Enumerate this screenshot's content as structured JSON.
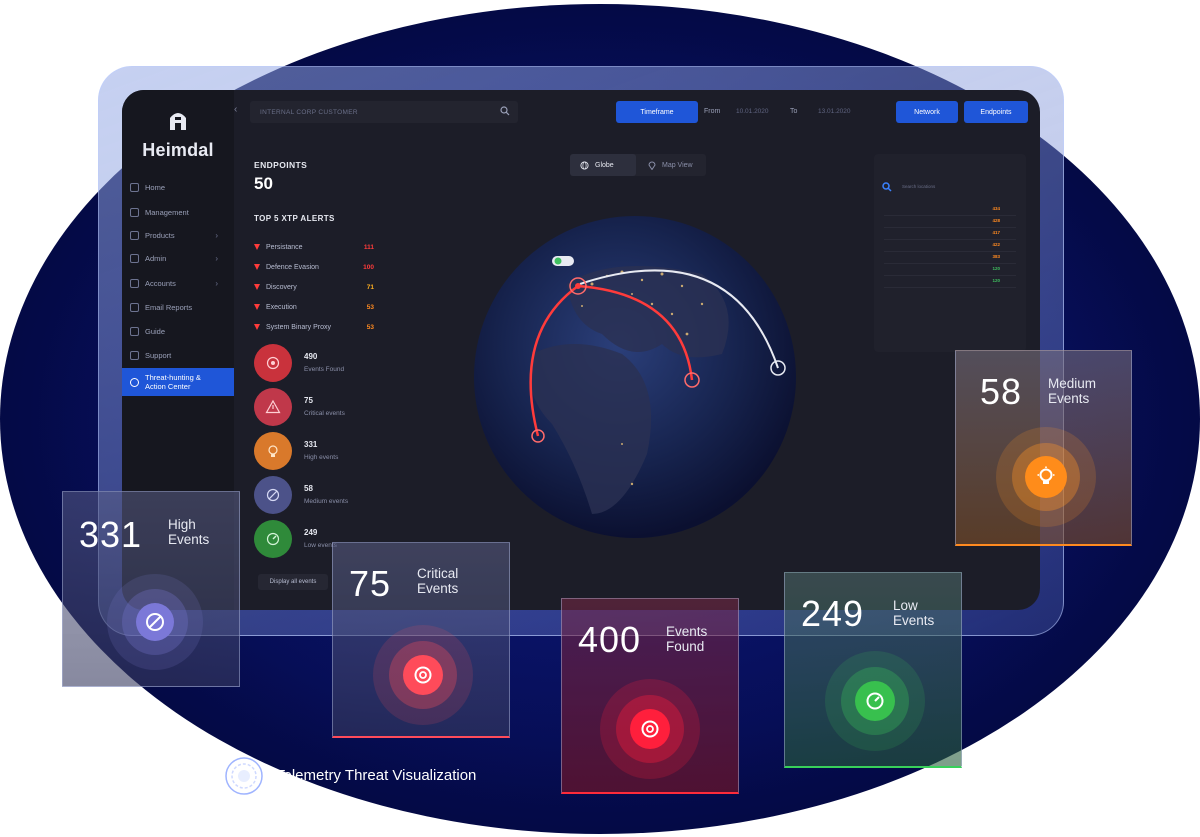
{
  "brand": {
    "name": "Heimdal"
  },
  "sidebar": {
    "items": [
      {
        "label": "Home"
      },
      {
        "label": "Management"
      },
      {
        "label": "Products"
      },
      {
        "label": "Admin"
      },
      {
        "label": "Accounts"
      },
      {
        "label": "Email Reports"
      },
      {
        "label": "Guide"
      },
      {
        "label": "Support"
      },
      {
        "label": "Threat-hunting & Action Center"
      }
    ]
  },
  "topbar": {
    "search_placeholder": "INTERNAL CORP CUSTOMER",
    "timeframe_label": "Timeframe",
    "from_label": "From",
    "from_value": "10.01.2020",
    "to_label": "To",
    "to_value": "13.01.2020",
    "network_label": "Network",
    "endpoints_label": "Endpoints"
  },
  "endpoints": {
    "label": "ENDPOINTS",
    "value": "50"
  },
  "xtp_alerts": {
    "title": "TOP 5 XTP ALERTS",
    "items": [
      {
        "name": "Persistance",
        "count": "111",
        "color": "#ff3b3b"
      },
      {
        "name": "Defence Evasion",
        "count": "100",
        "color": "#ff3b3b"
      },
      {
        "name": "Discovery",
        "count": "71",
        "color": "#ffb020"
      },
      {
        "name": "Execution",
        "count": "53",
        "color": "#ff8a20"
      },
      {
        "name": "System Binary Proxy",
        "count": "53",
        "color": "#ff8a20"
      }
    ]
  },
  "events": [
    {
      "value": "490",
      "label": "Events Found",
      "color": "#c9323c",
      "icon": "target-icon"
    },
    {
      "value": "75",
      "label": "Critical events",
      "color": "#c0384a",
      "icon": "warning-icon"
    },
    {
      "value": "331",
      "label": "High events",
      "color": "#d9792b",
      "icon": "bulb-icon"
    },
    {
      "value": "58",
      "label": "Medium events",
      "color": "#4c5289",
      "icon": "ban-icon"
    },
    {
      "value": "249",
      "label": "Low events",
      "color": "#2f8a3a",
      "icon": "gauge-icon"
    }
  ],
  "display_all_label": "Display all events",
  "view_toggle": {
    "globe": "Globe",
    "map": "Map View"
  },
  "right_panel": {
    "search_placeholder": "Search locations",
    "rows": [
      {
        "value": "434",
        "color": "#ff8a20"
      },
      {
        "value": "428",
        "color": "#ff8a20"
      },
      {
        "value": "417",
        "color": "#ff8a20"
      },
      {
        "value": "422",
        "color": "#ff8a20"
      },
      {
        "value": "383",
        "color": "#ff8a20"
      },
      {
        "value": "120",
        "color": "#3fbf5f"
      },
      {
        "value": "120",
        "color": "#3fbf5f"
      }
    ]
  },
  "cards": {
    "high": {
      "value": "331",
      "label": "High Events"
    },
    "critical": {
      "value": "75",
      "label": "Critical Events"
    },
    "found": {
      "value": "400",
      "label": "Events Found"
    },
    "low": {
      "value": "249",
      "label": "Low Events"
    },
    "medium": {
      "value": "58",
      "label": "Medium Events"
    }
  },
  "caption": "Telemetry Threat Visualization"
}
